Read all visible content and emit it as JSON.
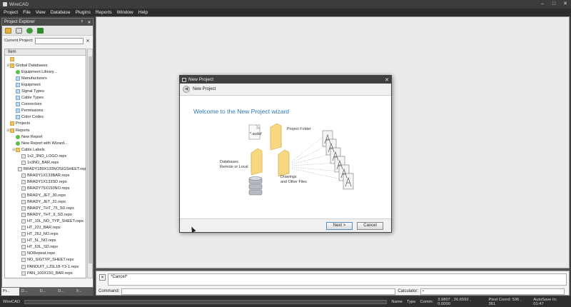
{
  "window": {
    "title": "WireCAD"
  },
  "menu": [
    "Project",
    "File",
    "View",
    "Database",
    "Plugins",
    "Reports",
    "Window",
    "Help"
  ],
  "explorer": {
    "title": "Project Explorer",
    "current_project_label": "Current Project:",
    "column_header": "Item",
    "tree": [
      {
        "label": "",
        "icon": "folder",
        "indent": 0,
        "toggle": ""
      },
      {
        "label": "Global Databases",
        "icon": "folder",
        "indent": 0,
        "toggle": "⊟"
      },
      {
        "label": "Equipment Library...",
        "icon": "green",
        "indent": 1,
        "toggle": ""
      },
      {
        "label": "Manufacturers",
        "icon": "table",
        "indent": 1,
        "toggle": ""
      },
      {
        "label": "Equipment",
        "icon": "table",
        "indent": 1,
        "toggle": ""
      },
      {
        "label": "Signal Types",
        "icon": "table",
        "indent": 1,
        "toggle": ""
      },
      {
        "label": "Cable Types",
        "icon": "table",
        "indent": 1,
        "toggle": ""
      },
      {
        "label": "Connectors",
        "icon": "table",
        "indent": 1,
        "toggle": ""
      },
      {
        "label": "Permissions",
        "icon": "table",
        "indent": 1,
        "toggle": ""
      },
      {
        "label": "Color Codes",
        "icon": "table",
        "indent": 1,
        "toggle": ""
      },
      {
        "label": "Projects",
        "icon": "folder",
        "indent": 0,
        "toggle": ""
      },
      {
        "label": "Reports",
        "icon": "folder",
        "indent": 0,
        "toggle": "⊟"
      },
      {
        "label": "New Report",
        "icon": "green",
        "indent": 1,
        "toggle": ""
      },
      {
        "label": "New Report with Wizard...",
        "icon": "green",
        "indent": 1,
        "toggle": ""
      },
      {
        "label": "Cable Labels",
        "icon": "folder",
        "indent": 1,
        "toggle": "⊟"
      },
      {
        "label": "1x2_3NO_LOGO.repx",
        "icon": "report",
        "indent": 2,
        "toggle": ""
      },
      {
        "label": "1x3NO_BAR.repx",
        "icon": "report",
        "indent": 2,
        "toggle": ""
      },
      {
        "label": "BRADY189X133NOSIGSHEET.repx",
        "icon": "report",
        "indent": 2,
        "toggle": ""
      },
      {
        "label": "BRADY1X133BAR.repx",
        "icon": "report",
        "indent": 2,
        "toggle": ""
      },
      {
        "label": "BRADY1X133SD.repx",
        "icon": "report",
        "indent": 2,
        "toggle": ""
      },
      {
        "label": "BRADY75X150NO.repx",
        "icon": "report",
        "indent": 2,
        "toggle": ""
      },
      {
        "label": "BRADY_JET_30.repx",
        "icon": "report",
        "indent": 2,
        "toggle": ""
      },
      {
        "label": "BRADY_JET_31.repx",
        "icon": "report",
        "indent": 2,
        "toggle": ""
      },
      {
        "label": "BRADY_THT_75_SD.repx",
        "icon": "report",
        "indent": 2,
        "toggle": ""
      },
      {
        "label": "BRADY_THT_9_SD.repx",
        "icon": "report",
        "indent": 2,
        "toggle": ""
      },
      {
        "label": "HT_10L_NO_TYP_SHEET.repx",
        "icon": "report",
        "indent": 2,
        "toggle": ""
      },
      {
        "label": "HT_22J_BAR.repx",
        "icon": "report",
        "indent": 2,
        "toggle": ""
      },
      {
        "label": "HT_26J_NO.repx",
        "icon": "report",
        "indent": 2,
        "toggle": ""
      },
      {
        "label": "HT_5L_NO.repx",
        "icon": "report",
        "indent": 2,
        "toggle": ""
      },
      {
        "label": "HT_63L_SD.repx",
        "icon": "report",
        "indent": 2,
        "toggle": ""
      },
      {
        "label": "NORepeat.repx",
        "icon": "report",
        "indent": 2,
        "toggle": ""
      },
      {
        "label": "NO_SIGTYP_SHEET.repx",
        "icon": "report",
        "indent": 2,
        "toggle": ""
      },
      {
        "label": "PANDUIT_LJSL18-Y3-1.repx",
        "icon": "report",
        "indent": 2,
        "toggle": ""
      },
      {
        "label": "PAN_100X150_BAR.repx",
        "icon": "report",
        "indent": 2,
        "toggle": ""
      },
      {
        "label": "PAN_100X150_NOSIGSHEET.repx",
        "icon": "report",
        "indent": 2,
        "toggle": ""
      }
    ],
    "bottom_tabs": [
      "Pr...",
      "D...",
      "D...",
      "D...",
      "F..."
    ]
  },
  "dialog": {
    "title": "New Project",
    "nav_title": "New Project",
    "heading": "Welcome to the New Project wizard",
    "labels": {
      "acdsf": "*.acdsf",
      "project_folder": "Project Folder",
      "databases_line1": "Databases",
      "databases_line2": "Remote or Local",
      "drawings_line1": "Drawings",
      "drawings_line2": "and Other Files"
    },
    "next_label": "Next >",
    "cancel_label": "Cancel"
  },
  "command": {
    "history": "*Cancel*",
    "command_label": "Command:",
    "calculator_label": "Calculator:",
    "calculator_value": "•"
  },
  "status": {
    "app": "WireCAD",
    "name_label": "Name",
    "type_label": "Type",
    "comm_label": "Comm:",
    "coords": "3.9807 , 26.6592 , 0.0000",
    "pixel_coords": "Pixel Coord: 536 , 361",
    "autosave": "AutoSave In: 01:47"
  },
  "colors": {
    "accent": "#2e79b8",
    "chrome": "#3c3c3c",
    "folder": "#f0c75e"
  }
}
